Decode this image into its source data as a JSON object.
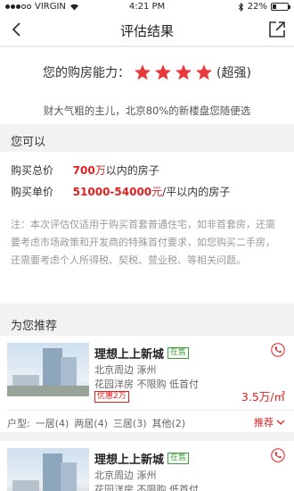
{
  "statusbar": {
    "carrier": "VIRGIN",
    "time": "4:21 PM",
    "battery": "22%",
    "battery_level": 0.22
  },
  "navbar": {
    "title": "评估结果",
    "back_icon": "chevron-left-icon",
    "share_icon": "share-icon"
  },
  "ability": {
    "label": "您的购房能力：",
    "stars": 4,
    "star_color": "#e8393c",
    "rating_text": "(超强)",
    "description": "财大气粗的主儿，北京80%的新楼盘您随便选"
  },
  "can_do": {
    "section_title": "您可以",
    "total_label": "购买总价",
    "total_value": "700",
    "total_unit": "万",
    "total_suffix": "以内的房子",
    "unit_label": "购买单价",
    "unit_value": "51000-54000",
    "unit_unit": "元",
    "unit_suffix": "/平以内的房子",
    "note": "注：本次评估仅适用于购买首套普通住宅，如非首套房，还需要考虑市场政策和开发商的特殊首付要求，如您购买二手房，还需要考虑个人所得税、契税、营业税、等相关问题。"
  },
  "recommend": {
    "section_title": "为您推荐",
    "accent_color": "#e02020",
    "listings": [
      {
        "name": "理想上上新城",
        "status": "在售",
        "location": "北京周边  涿州",
        "features": "花园洋房  不限购  低首付",
        "promo": "优惠2万",
        "price": "3.5万/㎡",
        "types_label": "户型:",
        "types": [
          "一居(4)",
          "两居(4)",
          "三居(3)",
          "其他(2)"
        ],
        "more_label": "推荐"
      },
      {
        "name": "理想上上新城",
        "status": "在售",
        "location": "北京周边  涿州",
        "features": "花园洋房  不限购  低首付"
      }
    ]
  }
}
